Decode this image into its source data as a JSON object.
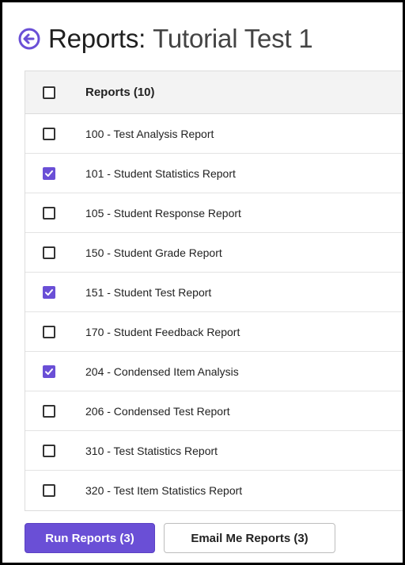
{
  "header": {
    "title_prefix": "Reports:",
    "title_name": "Tutorial Test 1",
    "back_icon": "circle-arrow-left-icon"
  },
  "table": {
    "header_label": "Reports (10)",
    "header_checked": false,
    "rows": [
      {
        "label": "100 - Test Analysis Report",
        "checked": false
      },
      {
        "label": "101 - Student Statistics Report",
        "checked": true
      },
      {
        "label": "105 - Student Response Report",
        "checked": false
      },
      {
        "label": "150 - Student Grade Report",
        "checked": false
      },
      {
        "label": "151 - Student Test Report",
        "checked": true
      },
      {
        "label": "170 - Student Feedback Report",
        "checked": false
      },
      {
        "label": "204 - Condensed Item Analysis",
        "checked": true
      },
      {
        "label": "206 - Condensed Test Report",
        "checked": false
      },
      {
        "label": "310 - Test Statistics Report",
        "checked": false
      },
      {
        "label": "320 - Test Item Statistics Report",
        "checked": false
      }
    ]
  },
  "actions": {
    "run_label": "Run Reports (3)",
    "email_label": "Email Me Reports (3)"
  },
  "colors": {
    "accent": "#6a4fd6",
    "header_bg": "#f3f3f3"
  }
}
